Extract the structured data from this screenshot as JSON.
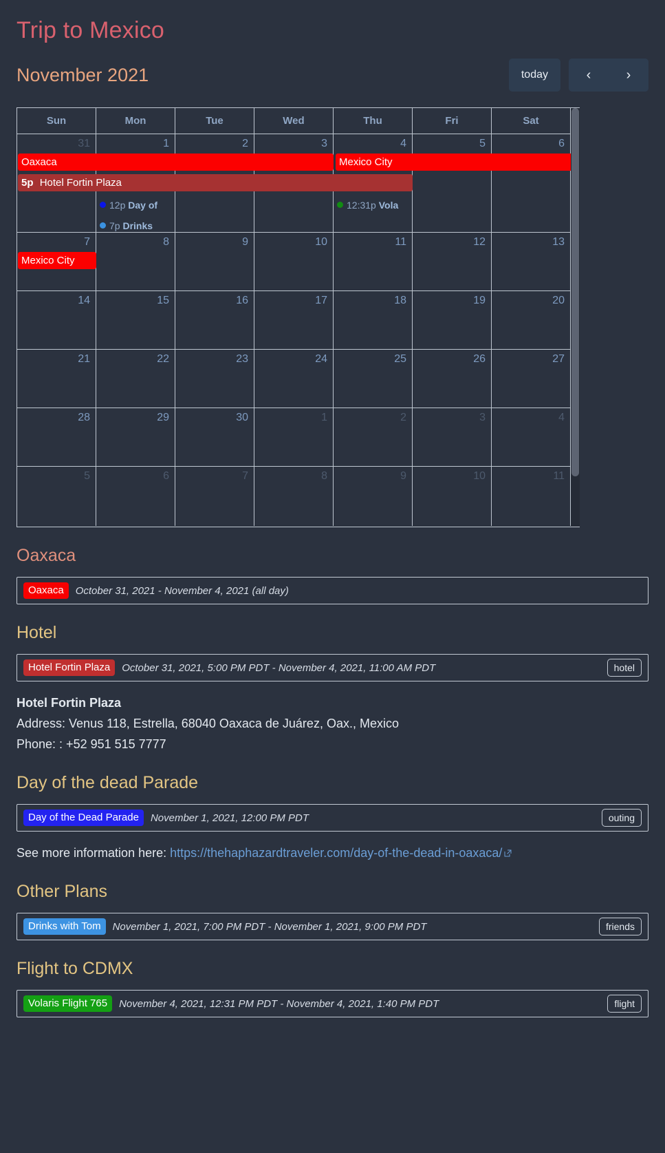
{
  "header": {
    "trip_title": "Trip to Mexico",
    "month_label": "November 2021",
    "today_label": "today",
    "prev_label": "‹",
    "next_label": "›"
  },
  "calendar": {
    "weekdays": [
      "Sun",
      "Mon",
      "Tue",
      "Wed",
      "Thu",
      "Fri",
      "Sat"
    ],
    "weeks": [
      {
        "days": [
          {
            "num": "31",
            "other": true
          },
          {
            "num": "1",
            "other": false
          },
          {
            "num": "2",
            "other": false
          },
          {
            "num": "3",
            "other": false
          },
          {
            "num": "4",
            "other": false
          },
          {
            "num": "5",
            "other": false
          },
          {
            "num": "6",
            "other": false
          }
        ]
      },
      {
        "days": [
          {
            "num": "7",
            "other": false
          },
          {
            "num": "8",
            "other": false
          },
          {
            "num": "9",
            "other": false
          },
          {
            "num": "10",
            "other": false
          },
          {
            "num": "11",
            "other": false
          },
          {
            "num": "12",
            "other": false
          },
          {
            "num": "13",
            "other": false
          }
        ]
      },
      {
        "days": [
          {
            "num": "14",
            "other": false
          },
          {
            "num": "15",
            "other": false
          },
          {
            "num": "16",
            "other": false
          },
          {
            "num": "17",
            "other": false
          },
          {
            "num": "18",
            "other": false
          },
          {
            "num": "19",
            "other": false
          },
          {
            "num": "20",
            "other": false
          }
        ]
      },
      {
        "days": [
          {
            "num": "21",
            "other": false
          },
          {
            "num": "22",
            "other": false
          },
          {
            "num": "23",
            "other": false
          },
          {
            "num": "24",
            "other": false
          },
          {
            "num": "25",
            "other": false
          },
          {
            "num": "26",
            "other": false
          },
          {
            "num": "27",
            "other": false
          }
        ]
      },
      {
        "days": [
          {
            "num": "28",
            "other": false
          },
          {
            "num": "29",
            "other": false
          },
          {
            "num": "30",
            "other": false
          },
          {
            "num": "1",
            "other": true
          },
          {
            "num": "2",
            "other": true
          },
          {
            "num": "3",
            "other": true
          },
          {
            "num": "4",
            "other": true
          }
        ]
      },
      {
        "days": [
          {
            "num": "5",
            "other": true
          },
          {
            "num": "6",
            "other": true
          },
          {
            "num": "7",
            "other": true
          },
          {
            "num": "8",
            "other": true
          },
          {
            "num": "9",
            "other": true
          },
          {
            "num": "10",
            "other": true
          },
          {
            "num": "11",
            "other": true
          }
        ]
      }
    ],
    "events": {
      "oaxaca_bar": "Oaxaca",
      "mexico_city_bar": "Mexico City",
      "hotel_bar_time": "5p",
      "hotel_bar_title": "Hotel Fortin Plaza",
      "parade_time": "12p",
      "parade_title": "Day of",
      "drinks_time": "7p",
      "drinks_title": "Drinks",
      "flight_time": "12:31p",
      "flight_title": "Vola",
      "mexico_city_week2": "Mexico City"
    }
  },
  "sections": [
    {
      "title": "Oaxaca",
      "title_color": "coral",
      "event": {
        "badge": "Oaxaca",
        "badge_color": "red",
        "when": "October 31, 2021 - November 4, 2021 (all day)",
        "tag": null
      },
      "body": []
    },
    {
      "title": "Hotel",
      "title_color": "yellow",
      "event": {
        "badge": "Hotel Fortin Plaza",
        "badge_color": "dred",
        "when": "October 31, 2021, 5:00 PM PDT - November 4, 2021, 11:00 AM PDT",
        "tag": "hotel"
      },
      "body": [
        {
          "type": "bold",
          "text": "Hotel Fortin Plaza"
        },
        {
          "type": "plain",
          "text": "Address: Venus 118, Estrella, 68040 Oaxaca de Juárez, Oax., Mexico"
        },
        {
          "type": "plain",
          "text": "Phone: : +52 951 515 7777"
        }
      ]
    },
    {
      "title": "Day of the dead Parade",
      "title_color": "yellow",
      "event": {
        "badge": "Day of the Dead Parade",
        "badge_color": "blue",
        "when": "November 1, 2021, 12:00 PM PDT",
        "tag": "outing"
      },
      "body": [
        {
          "type": "link-line",
          "prefix": "See more information here: ",
          "link": "https://thehaphazardtraveler.com/day-of-the-dead-in-oaxaca/"
        }
      ]
    },
    {
      "title": "Other Plans",
      "title_color": "yellow",
      "event": {
        "badge": "Drinks with Tom",
        "badge_color": "lblue",
        "when": "November 1, 2021, 7:00 PM PDT - November 1, 2021, 9:00 PM PDT",
        "tag": "friends"
      },
      "body": []
    },
    {
      "title": "Flight to CDMX",
      "title_color": "yellow",
      "event": {
        "badge": "Volaris Flight 765",
        "badge_color": "green",
        "when": "November 4, 2021, 12:31 PM PDT - November 4, 2021, 1:40 PM PDT",
        "tag": "flight"
      },
      "body": []
    }
  ],
  "colors": {
    "background": "#2b323f",
    "trip_title": "#d9616e",
    "month_label": "#e8a57f",
    "section_coral": "#e0907d",
    "section_yellow": "#e3c583",
    "event_red": "#fc0000",
    "event_dark_red": "#a63232",
    "event_blue": "#2323f0",
    "event_light_blue": "#3d93e2",
    "event_green": "#14a014",
    "link": "#6b9ed6"
  }
}
